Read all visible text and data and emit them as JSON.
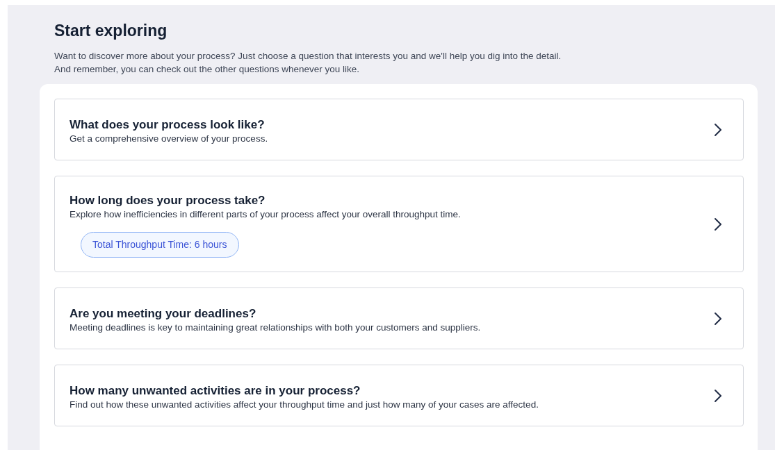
{
  "heading": "Start exploring",
  "intro_lines": [
    "Want to discover more about your process? Just choose a question that interests you and we'll help you dig into the detail.",
    "And remember, you can check out the other questions whenever you like."
  ],
  "questions": [
    {
      "title": "What does your process look like?",
      "description": "Get a comprehensive overview of your process."
    },
    {
      "title": "How long does your process take?",
      "description": "Explore how inefficiencies in different parts of your process affect your overall throughput time.",
      "badge": "Total Throughput Time: 6 hours"
    },
    {
      "title": "Are you meeting your deadlines?",
      "description": "Meeting deadlines is key to maintaining great relationships with both your customers and suppliers."
    },
    {
      "title": "How many unwanted activities are in your process?",
      "description": "Find out how these unwanted activities affect your throughput time and just how many of your cases are affected."
    }
  ]
}
